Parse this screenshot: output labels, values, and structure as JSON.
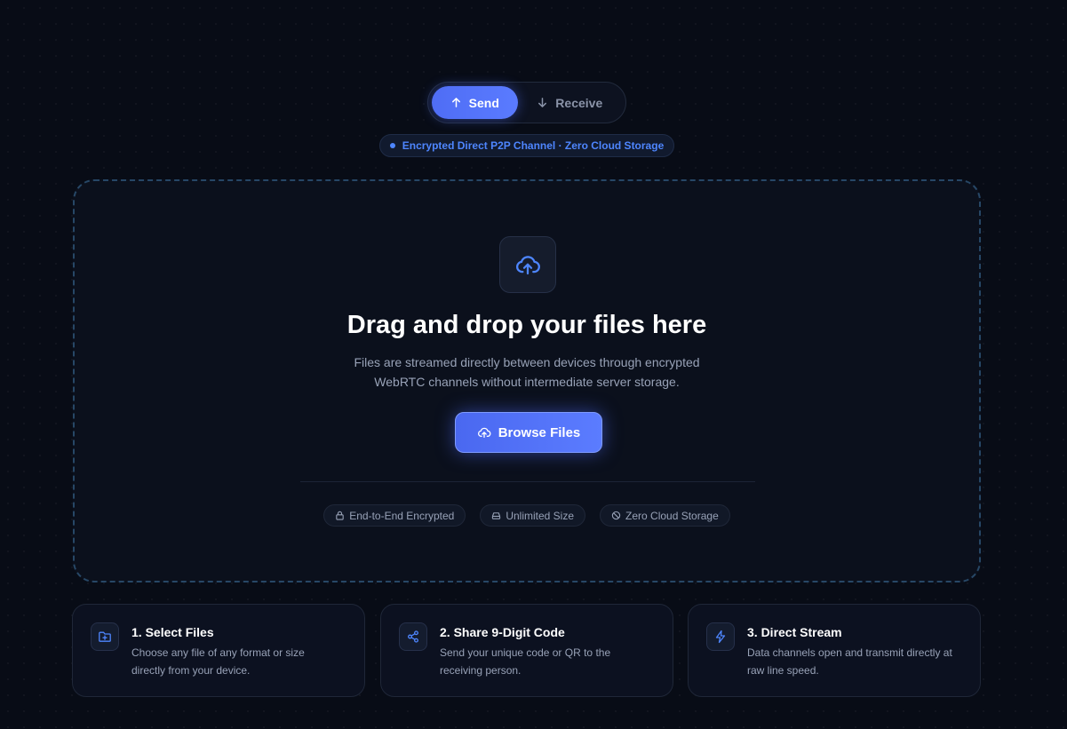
{
  "mode_toggle": {
    "send_label": "Send",
    "receive_label": "Receive",
    "active": "send"
  },
  "notice": "Encrypted Direct P2P Channel · Zero Cloud Storage",
  "drop_zone": {
    "title": "Drag and drop your files here",
    "description_line1": "Files are streamed directly between devices through encrypted",
    "description_line2": "WebRTC channels without intermediate server storage.",
    "browse_label": "Browse Files"
  },
  "badges": [
    {
      "label": "End-to-End Encrypted",
      "icon": "lock-icon"
    },
    {
      "label": "Unlimited Size",
      "icon": "drive-icon"
    },
    {
      "label": "Zero Cloud Storage",
      "icon": "block-icon"
    }
  ],
  "steps": [
    {
      "title": "1. Select Files",
      "line1": "Choose any file of any format or size",
      "line2": "directly from your device.",
      "icon": "folder-plus-icon"
    },
    {
      "title": "2. Share 9-Digit Code",
      "line1": "Send your unique code or QR to the",
      "line2": "receiving person.",
      "icon": "share-icon"
    },
    {
      "title": "3. Direct Stream",
      "line1": "Data channels open and transmit directly at",
      "line2": "raw line speed.",
      "icon": "lightning-icon"
    }
  ],
  "colors": {
    "accent": "#4f6df5",
    "accent_light": "#4e86ff",
    "background": "#080c16"
  }
}
